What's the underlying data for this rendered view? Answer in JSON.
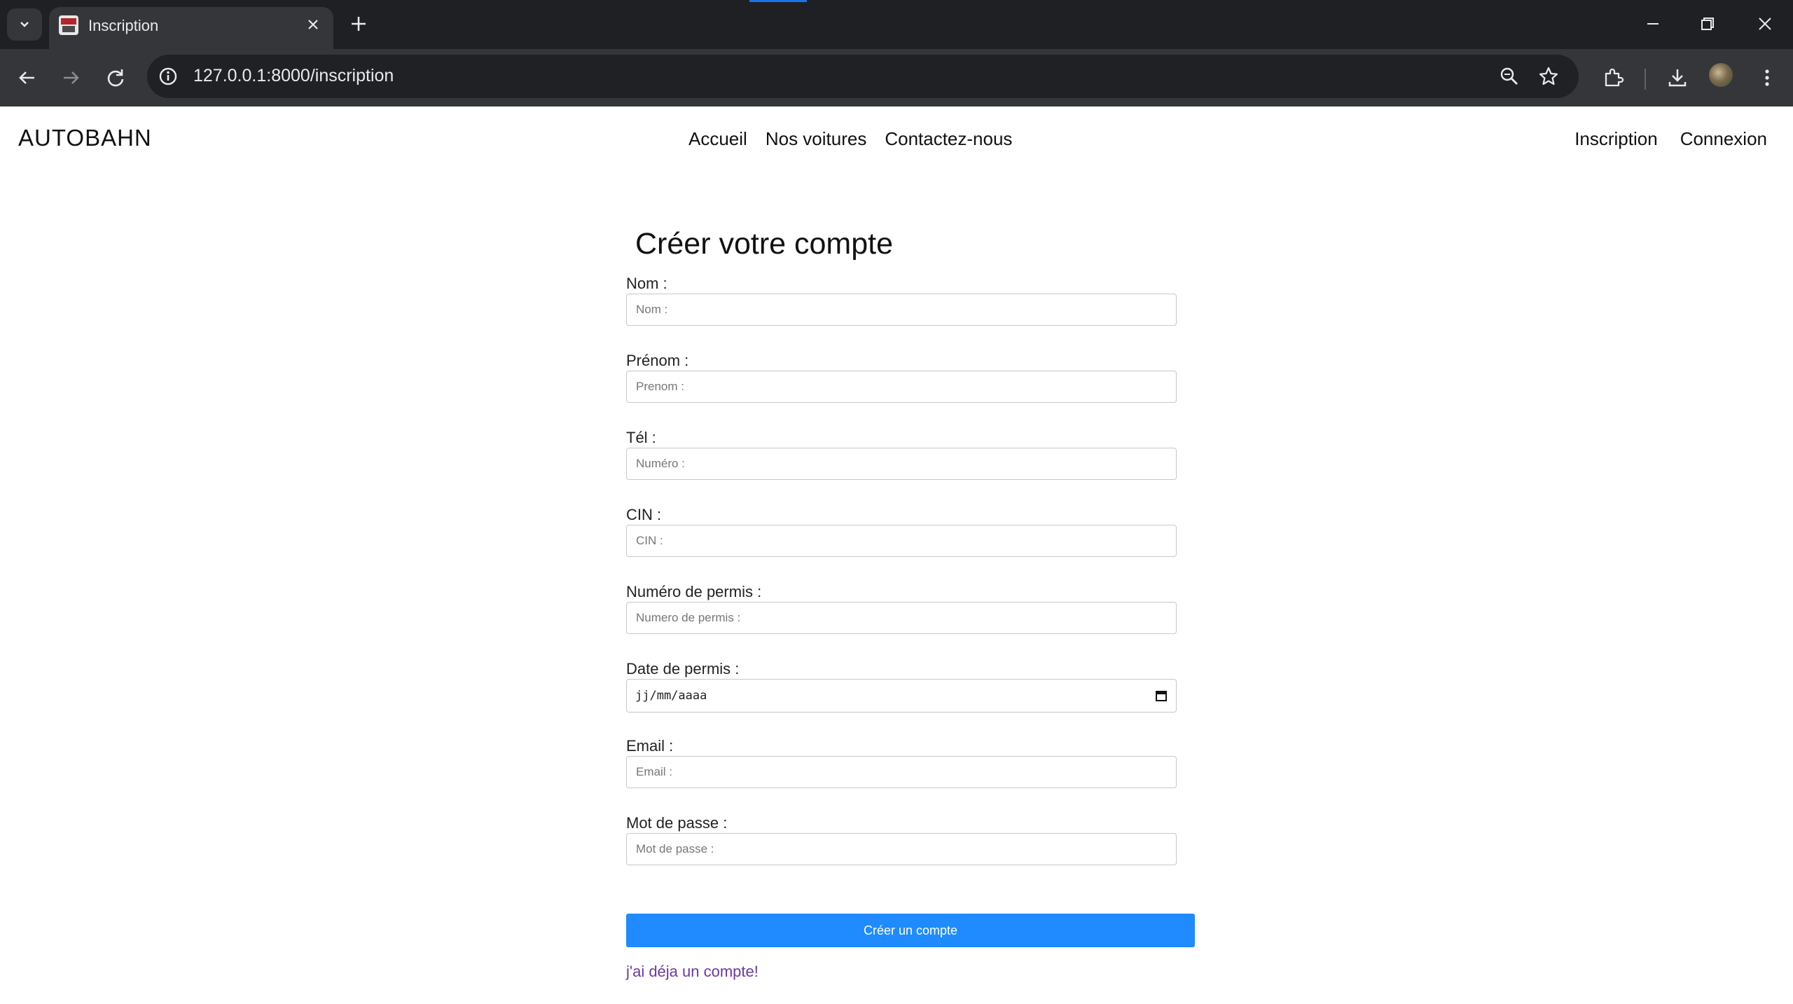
{
  "browser": {
    "tab_title": "Inscription",
    "url": "127.0.0.1:8000/inscription"
  },
  "site": {
    "brand": "AUTOBAHN",
    "nav": [
      "Accueil",
      "Nos voitures",
      "Contactez-nous"
    ],
    "auth": [
      "Inscription",
      "Connexion"
    ]
  },
  "form": {
    "title": "Créer votre compte",
    "fields": [
      {
        "label": "Nom :",
        "placeholder": "Nom :"
      },
      {
        "label": "Prénom :",
        "placeholder": "Prenom :"
      },
      {
        "label": "Tél :",
        "placeholder": "Numéro :"
      },
      {
        "label": "CIN :",
        "placeholder": "CIN :"
      },
      {
        "label": "Numéro de permis :",
        "placeholder": "Numero de permis :"
      },
      {
        "label": "Date de permis :",
        "value": "jj/mm/aaaa"
      },
      {
        "label": "Email :",
        "placeholder": "Email :"
      },
      {
        "label": "Mot de passe :",
        "placeholder": "Mot de passe :"
      }
    ],
    "submit_label": "Créer un compte",
    "login_link": "j'ai déja un compte!"
  }
}
